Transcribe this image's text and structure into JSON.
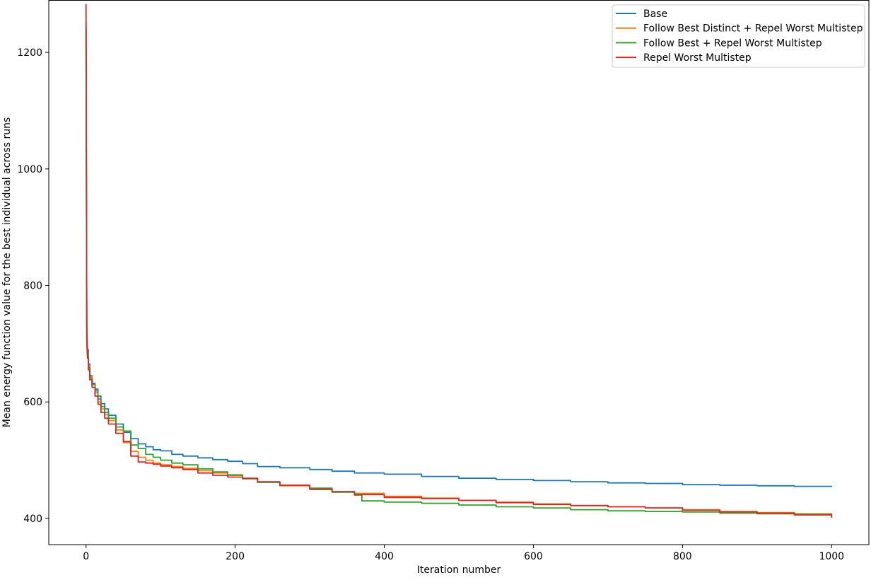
{
  "chart_data": {
    "type": "line",
    "title": "",
    "xlabel": "Iteration number",
    "ylabel": "Mean energy function value for the best individual across runs",
    "xlim": [
      -50,
      1050
    ],
    "ylim": [
      355,
      1290
    ],
    "xticks": [
      0,
      200,
      400,
      600,
      800,
      1000
    ],
    "yticks": [
      400,
      600,
      800,
      1000,
      1200
    ],
    "grid": false,
    "legend_position": "top-right",
    "series": [
      {
        "name": "Base",
        "color": "#1f77b4",
        "x": [
          0,
          1,
          2,
          3,
          5,
          8,
          12,
          16,
          20,
          25,
          30,
          40,
          50,
          60,
          70,
          80,
          90,
          100,
          115,
          130,
          150,
          170,
          190,
          210,
          230,
          260,
          300,
          330,
          360,
          400,
          450,
          500,
          550,
          600,
          650,
          700,
          750,
          800,
          850,
          900,
          950,
          1000
        ],
        "y": [
          1240,
          730,
          690,
          665,
          645,
          632,
          622,
          610,
          597,
          588,
          577,
          562,
          548,
          537,
          528,
          523,
          518,
          516,
          510,
          507,
          504,
          501,
          498,
          494,
          489,
          487,
          484,
          481,
          478,
          476,
          472,
          469,
          467,
          465,
          463,
          461,
          460,
          458,
          457,
          456,
          455,
          454
        ]
      },
      {
        "name": "Follow Best Distinct + Repel Worst Multistep",
        "color": "#ff7f0e",
        "x": [
          0,
          1,
          2,
          3,
          5,
          8,
          12,
          16,
          20,
          25,
          30,
          40,
          50,
          60,
          70,
          80,
          90,
          100,
          115,
          130,
          150,
          170,
          190,
          210,
          230,
          260,
          300,
          330,
          360,
          400,
          450,
          500,
          550,
          600,
          650,
          700,
          750,
          800,
          850,
          900,
          950,
          1000
        ],
        "y": [
          1250,
          700,
          678,
          662,
          643,
          630,
          616,
          600,
          588,
          578,
          568,
          552,
          530,
          515,
          505,
          500,
          495,
          492,
          489,
          486,
          482,
          478,
          475,
          468,
          462,
          456,
          450,
          446,
          443,
          438,
          435,
          431,
          428,
          425,
          422,
          420,
          418,
          415,
          412,
          410,
          408,
          406
        ]
      },
      {
        "name": "Follow Best + Repel Worst Multistep",
        "color": "#2ca02c",
        "x": [
          0,
          1,
          2,
          3,
          5,
          8,
          12,
          16,
          20,
          25,
          30,
          40,
          50,
          60,
          70,
          80,
          90,
          100,
          115,
          130,
          150,
          170,
          190,
          210,
          230,
          260,
          300,
          330,
          360,
          370,
          400,
          450,
          500,
          550,
          600,
          650,
          700,
          750,
          800,
          850,
          900,
          950,
          1000
        ],
        "y": [
          1245,
          710,
          680,
          660,
          641,
          630,
          619,
          605,
          592,
          582,
          572,
          557,
          550,
          526,
          520,
          510,
          505,
          500,
          495,
          492,
          485,
          480,
          474,
          468,
          462,
          457,
          452,
          445,
          440,
          430,
          428,
          426,
          423,
          420,
          418,
          415,
          413,
          412,
          411,
          409,
          408,
          407,
          406
        ]
      },
      {
        "name": "Repel Worst Multistep",
        "color": "#d62728",
        "x": [
          0,
          1,
          2,
          3,
          5,
          8,
          12,
          16,
          20,
          25,
          30,
          40,
          50,
          60,
          70,
          80,
          90,
          100,
          115,
          130,
          150,
          170,
          190,
          210,
          230,
          260,
          300,
          330,
          360,
          400,
          450,
          500,
          550,
          600,
          650,
          700,
          750,
          800,
          850,
          900,
          950,
          1000
        ],
        "y": [
          1283,
          705,
          675,
          655,
          638,
          625,
          610,
          596,
          582,
          572,
          562,
          546,
          532,
          507,
          497,
          495,
          493,
          490,
          487,
          484,
          478,
          474,
          471,
          469,
          463,
          457,
          450,
          446,
          441,
          436,
          434,
          431,
          427,
          424,
          422,
          420,
          418,
          414,
          411,
          409,
          406,
          401
        ]
      }
    ]
  }
}
